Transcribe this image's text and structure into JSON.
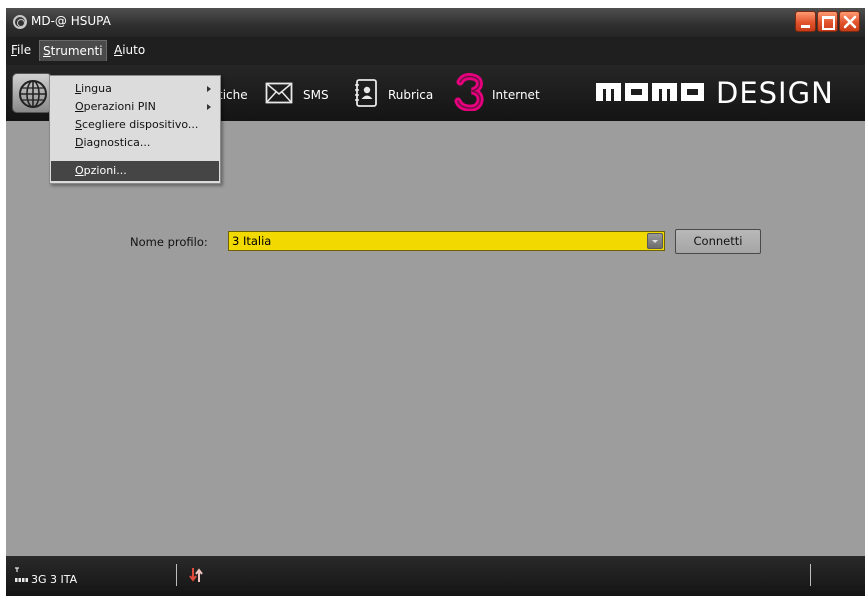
{
  "window": {
    "title": "MD-@ HSUPA",
    "accent_color": "#f2d900",
    "close_color": "#e2542c"
  },
  "menubar": {
    "items": [
      {
        "label_accel": "F",
        "label_rest": "ile"
      },
      {
        "label_accel": "S",
        "label_rest": "trumenti"
      },
      {
        "label_accel": "A",
        "label_rest": "iuto"
      }
    ]
  },
  "strumenti_menu": {
    "items": [
      {
        "accel": "L",
        "rest": "ingua",
        "submenu": true
      },
      {
        "accel": "O",
        "rest": "perazioni PIN",
        "submenu": true
      },
      {
        "accel": "S",
        "rest": "cegliere dispositivo...",
        "submenu": false
      },
      {
        "accel": "D",
        "rest": "iagnostica...",
        "submenu": false
      },
      {
        "accel": "O",
        "rest": "pzioni...",
        "submenu": false,
        "highlighted": true
      }
    ]
  },
  "toolbar": {
    "statistiche_partial": "tiche",
    "sms_label": "SMS",
    "rubrica_label": "Rubrica",
    "internet_label": "Internet",
    "brand_strong": "MOMO",
    "brand_light": "DESIGN",
    "icons": [
      "globe-icon",
      "envelope-icon",
      "address-book-icon",
      "three-logo-icon"
    ]
  },
  "main": {
    "profile_label": "Nome profilo:",
    "profile_value": "3 Italia",
    "connect_label": "Connetti"
  },
  "statusbar": {
    "network": "3G 3 ITA",
    "icons": [
      "signal-strength-icon",
      "data-transfer-icon"
    ]
  }
}
